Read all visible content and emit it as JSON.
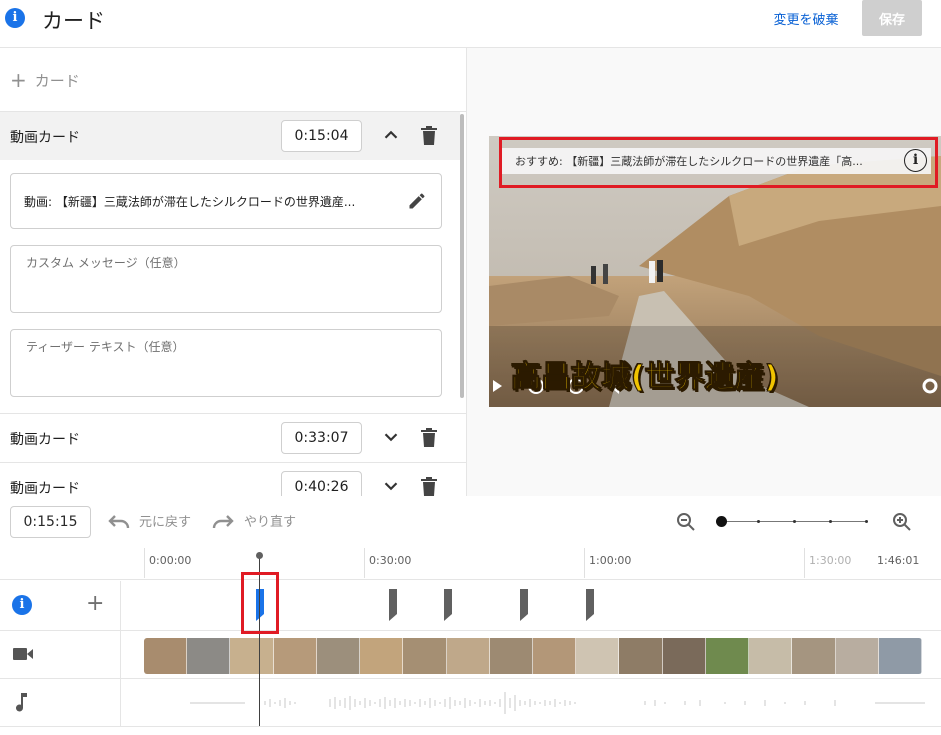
{
  "header": {
    "title": "カード",
    "discard_label": "変更を破棄",
    "save_label": "保存"
  },
  "left": {
    "add_card_label": "カード",
    "cards": [
      {
        "title": "動画カード",
        "time": "0:15:04"
      },
      {
        "title": "動画カード",
        "time": "0:33:07"
      },
      {
        "title": "動画カード",
        "time": "0:40:26"
      }
    ],
    "video_field": "動画: 【新疆】三蔵法師が滞在したシルクロードの世界遺産...",
    "custom_message_placeholder": "カスタム メッセージ（任意）",
    "teaser_placeholder": "ティーザー テキスト（任意）"
  },
  "preview": {
    "teaser": "おすすめ: 【新疆】三蔵法師が滞在したシルクロードの世界遺産「高...",
    "caption": "高昌故城(世界遺産)"
  },
  "timeline": {
    "current_time": "0:15:15",
    "undo_label": "元に戻す",
    "redo_label": "やり直す",
    "ruler_labels": [
      "0:00:00",
      "0:30:00",
      "1:00:00",
      "1:30:00",
      "1:46:01"
    ],
    "marker_times": [
      "0:15:04",
      "0:33:07",
      "0:40:26",
      "0:48:00",
      "0:59:00"
    ]
  },
  "colors": {
    "accent": "#1a73e8",
    "highlight": "#e01b24",
    "link": "#065fd4"
  }
}
